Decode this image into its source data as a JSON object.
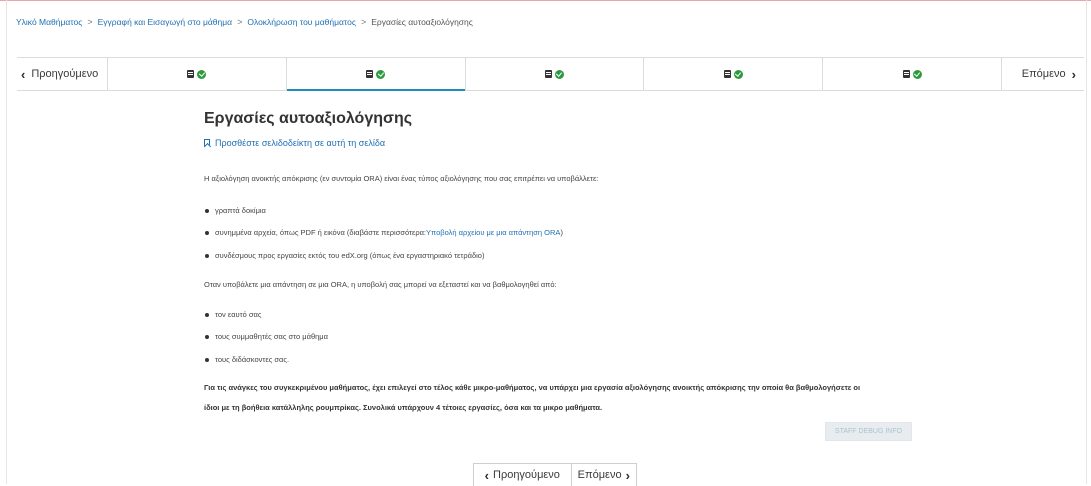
{
  "breadcrumb": {
    "items": [
      "Υλικό Μαθήματος",
      "Εγγραφή και Εισαγωγή στο μάθημα",
      "Ολοκλήρωση του μαθήματος"
    ],
    "current": "Εργασίες αυτοαξιολόγησης",
    "separator": ">"
  },
  "sequence_nav": {
    "prev_label": "Προηγούμενο",
    "next_label": "Επόμενο",
    "active_index": 1,
    "units": [
      {
        "icon": "document-icon",
        "status": "check-circle-icon"
      },
      {
        "icon": "document-icon",
        "status": "check-circle-icon"
      },
      {
        "icon": "document-icon",
        "status": "check-circle-icon"
      },
      {
        "icon": "document-icon",
        "status": "check-circle-icon"
      },
      {
        "icon": "document-icon",
        "status": "check-circle-icon"
      }
    ]
  },
  "main": {
    "title": "Εργασίες αυτοαξιολόγησης",
    "bookmark_label": "Προσθέστε σελιδοδείκτη σε αυτή τη σελίδα",
    "intro": "Η αξιολόγηση ανοικτής απόκρισης (εν συντομία ORA) είναι ένας τύπος αξιολόγησης που σας επιτρέπει να υποβάλλετε:",
    "list1": {
      "item1": "γραπτά δοκίμια",
      "item2_prefix": "συνημμένα αρχεία, όπως PDF ή εικόνα (διαβάστε περισσότερα: ",
      "item2_link": "Υποβολή αρχείου με μια απάντηση ORA",
      "item2_suffix": ")",
      "item3": "συνδέσμους προς εργασίες εκτός του edX.org (όπως ένα εργαστηριακό τετράδιο)"
    },
    "middle": "Οταν υποβάλετε μια απάντηση σε μια ORA, η υποβολή σας μπορεί να εξεταστεί και να βαθμολογηθεί από:",
    "list2": [
      "τον εαυτό σας",
      "τους συμμαθητές σας στο μάθημα",
      "τους διδάσκοντες σας."
    ],
    "closing_line1": "Για τις ανάγκες του συγκεκριμένου μαθήματος, έχει επιλεγεί στο τέλος κάθε μικρο-μαθήματος, να υπάρχει μια εργασία αξιολόγησης ανοικτής απόκρισης την οποία θα βαθμολογήσετε οι",
    "closing_line2": "ίδιοι με τη βοήθεια κατάλληλης ρουμπρίκας. Συνολικά υπάρχουν 4 τέτοιες εργασίες, όσα και τα μικρο μαθήματα.",
    "staff_debug_label": "STAFF DEBUG INFO"
  },
  "bottom_nav": {
    "prev_label": "Προηγούμενο",
    "next_label": "Επόμενο"
  },
  "colors": {
    "link": "#1f6fb3",
    "active_tab": "#1a8fb8",
    "complete": "#2e9a3f"
  }
}
